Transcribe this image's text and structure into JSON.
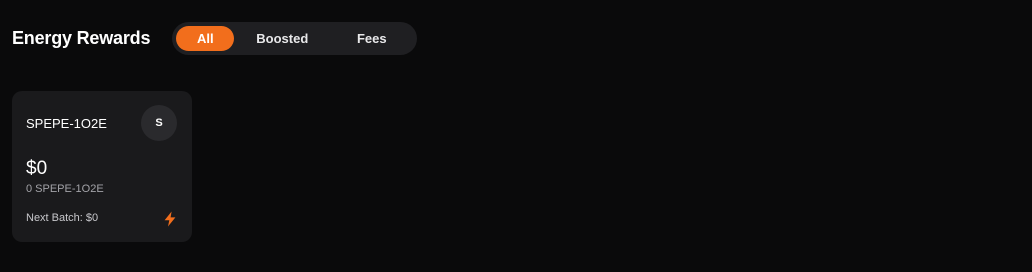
{
  "header": {
    "title": "Energy Rewards"
  },
  "tabs": [
    {
      "label": "All",
      "active": true
    },
    {
      "label": "Boosted",
      "active": false
    },
    {
      "label": "Fees",
      "active": false
    }
  ],
  "cards": [
    {
      "token": "SPEPE-1O2E",
      "avatar_letter": "S",
      "amount": "$0",
      "sub_amount": "0 SPEPE-1O2E",
      "next_batch": "Next Batch: $0",
      "icon": "lightning-bolt-icon"
    }
  ],
  "colors": {
    "background": "#0a0a0b",
    "accent": "#f26e1c",
    "card": "#1a1a1c",
    "tabs_track": "#1f1f22"
  }
}
